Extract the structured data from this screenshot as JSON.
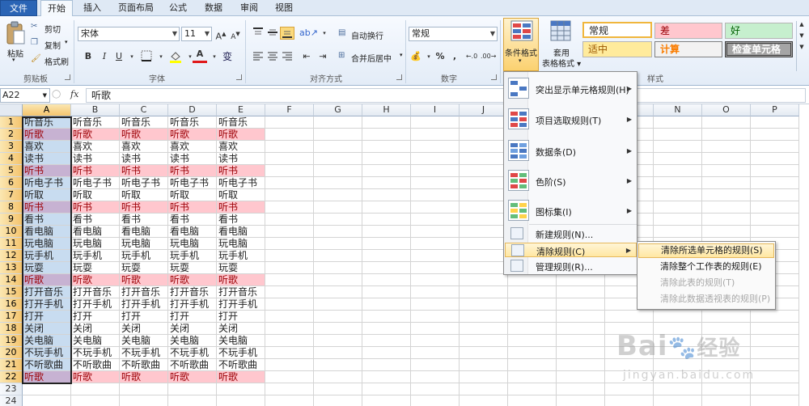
{
  "tabs": [
    "文件",
    "开始",
    "插入",
    "页面布局",
    "公式",
    "数据",
    "审阅",
    "视图"
  ],
  "clipboard": {
    "paste": "粘贴",
    "cut": "剪切",
    "copy": "复制",
    "format_painter": "格式刷",
    "label": "剪贴板"
  },
  "font": {
    "name": "宋体",
    "size": "11",
    "bold": "B",
    "italic": "I",
    "underline": "U",
    "label": "字体"
  },
  "alignment": {
    "wrap": "自动换行",
    "merge": "合并后居中",
    "label": "对齐方式"
  },
  "number": {
    "format": "常规",
    "percent": "%",
    "comma": ",",
    "label": "数字"
  },
  "styles_group": {
    "cond_format": "条件格式",
    "table_format": "套用\n表格格式",
    "label": "样式",
    "normal": "常规",
    "bad": "差",
    "good": "好",
    "neutral": "适中",
    "calc": "计算",
    "check": "检查单元格",
    "colors": {
      "normal_border": "#f0b63c",
      "bad_bg": "#ffc7ce",
      "bad_fg": "#9c0006",
      "good_bg": "#c6efce",
      "good_fg": "#006100",
      "neutral_bg": "#ffeb9c",
      "neutral_fg": "#9c5700",
      "calc_bg": "#f2f2f2",
      "calc_fg": "#fa7d00",
      "check_bg": "#a5a5a5",
      "check_fg": "#ffffff"
    }
  },
  "formula_bar": {
    "name_box": "A22",
    "fx": "fx",
    "content": "听歌"
  },
  "columns": [
    "A",
    "B",
    "C",
    "D",
    "E",
    "F",
    "G",
    "H",
    "I",
    "J",
    "K",
    "L",
    "M",
    "N",
    "O",
    "P"
  ],
  "rows": [
    {
      "n": "1",
      "v": "听音乐",
      "pink": false
    },
    {
      "n": "2",
      "v": "听歌",
      "pink": true
    },
    {
      "n": "3",
      "v": "喜欢",
      "pink": false
    },
    {
      "n": "4",
      "v": "读书",
      "pink": false
    },
    {
      "n": "5",
      "v": "听书",
      "pink": true
    },
    {
      "n": "6",
      "v": "听电子书",
      "pink": false
    },
    {
      "n": "7",
      "v": "听取",
      "pink": false
    },
    {
      "n": "8",
      "v": "听书",
      "pink": true
    },
    {
      "n": "9",
      "v": "看书",
      "pink": false
    },
    {
      "n": "10",
      "v": "看电脑",
      "pink": false
    },
    {
      "n": "11",
      "v": "玩电脑",
      "pink": false
    },
    {
      "n": "12",
      "v": "玩手机",
      "pink": false
    },
    {
      "n": "13",
      "v": "玩耍",
      "pink": false
    },
    {
      "n": "14",
      "v": "听歌",
      "pink": true
    },
    {
      "n": "15",
      "v": "打开音乐",
      "pink": false
    },
    {
      "n": "16",
      "v": "打开手机",
      "pink": false
    },
    {
      "n": "17",
      "v": "打开",
      "pink": false
    },
    {
      "n": "18",
      "v": "关闭",
      "pink": false
    },
    {
      "n": "19",
      "v": "关电脑",
      "pink": false
    },
    {
      "n": "20",
      "v": "不玩手机",
      "pink": false
    },
    {
      "n": "21",
      "v": "不听歌曲",
      "pink": false
    },
    {
      "n": "22",
      "v": "听歌",
      "pink": true
    },
    {
      "n": "23",
      "v": "",
      "pink": false
    },
    {
      "n": "24",
      "v": "",
      "pink": false
    }
  ],
  "cf_menu": [
    {
      "label": "突出显示单元格规则(H)",
      "icon": "highlight-rules-icon",
      "sub": true
    },
    {
      "label": "项目选取规则(T)",
      "icon": "top-bottom-rules-icon",
      "sub": true
    },
    {
      "label": "数据条(D)",
      "icon": "data-bars-icon",
      "sub": true
    },
    {
      "label": "色阶(S)",
      "icon": "color-scales-icon",
      "sub": true
    },
    {
      "label": "图标集(I)",
      "icon": "icon-sets-icon",
      "sub": true
    },
    {
      "label": "新建规则(N)...",
      "icon": "new-rule-icon",
      "sub": false
    },
    {
      "label": "清除规则(C)",
      "icon": "clear-rules-icon",
      "sub": true
    },
    {
      "label": "管理规则(R)...",
      "icon": "manage-rules-icon",
      "sub": false
    }
  ],
  "submenu": [
    {
      "label": "清除所选单元格的规则(S)",
      "disabled": false
    },
    {
      "label": "清除整个工作表的规则(E)",
      "disabled": false
    },
    {
      "label": "清除此表的规则(T)",
      "disabled": true
    },
    {
      "label": "清除此数据透视表的规则(P)",
      "disabled": true
    }
  ],
  "watermark": {
    "brand": "Bai",
    "brand2": "经验",
    "url": "jingyan.baidu.com"
  }
}
